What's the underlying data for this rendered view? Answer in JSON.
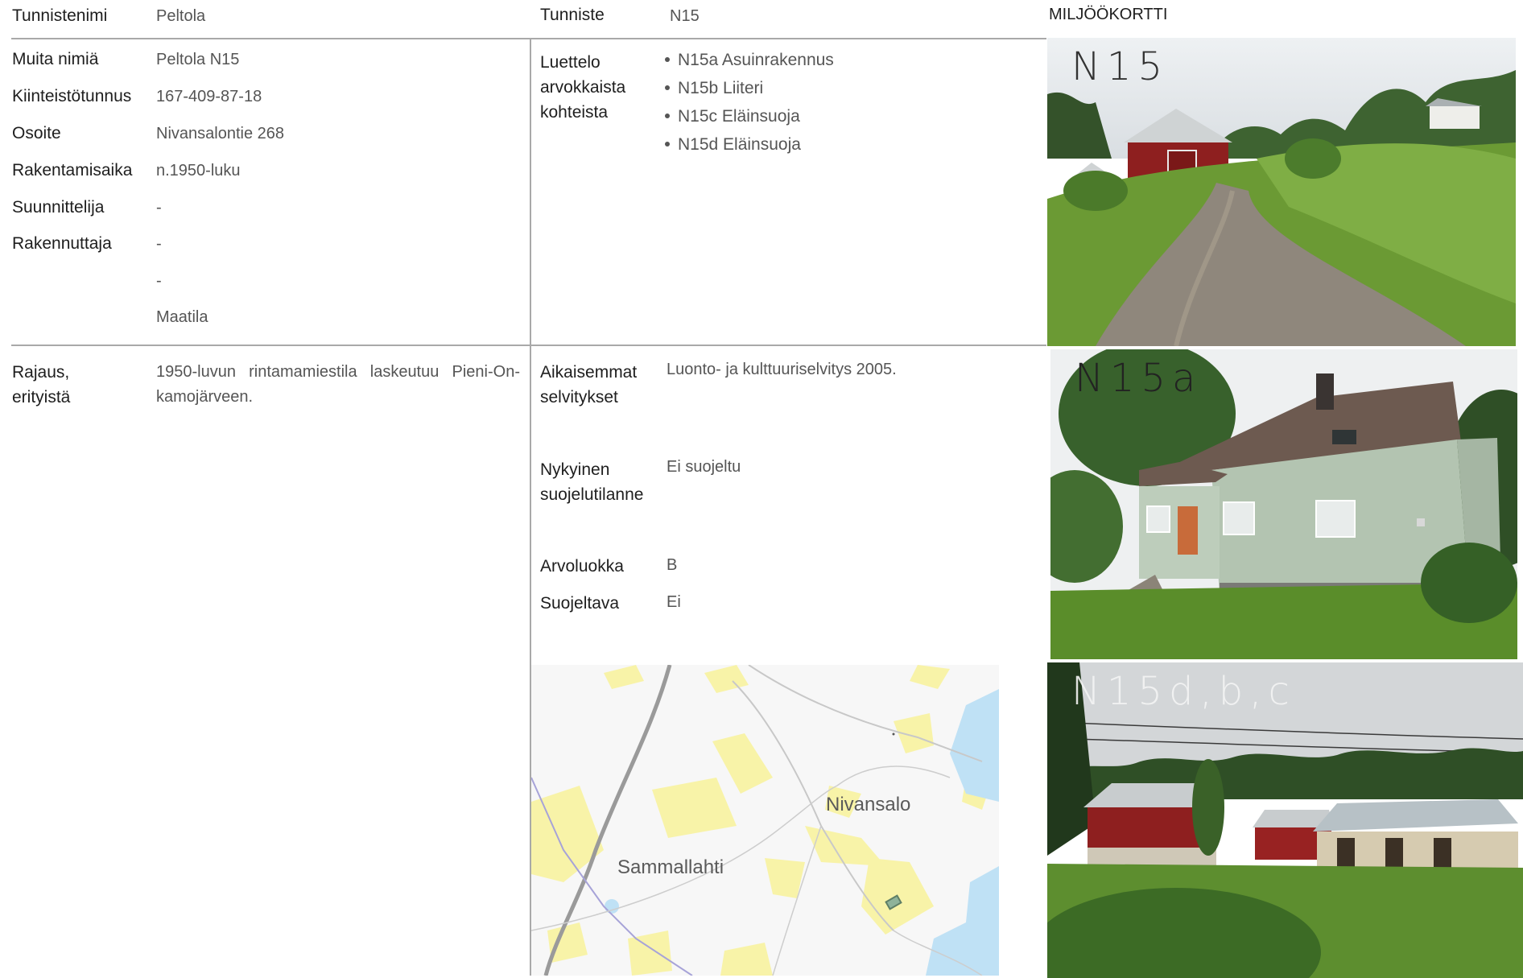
{
  "header": {
    "name_label": "Tunnistenimi",
    "name_value": "Peltola",
    "id_label": "Tunniste",
    "id_value": "N15",
    "card_title": "MILJÖÖKORTTI"
  },
  "fields": [
    {
      "label": "Muita nimiä",
      "value": "Peltola N15"
    },
    {
      "label": "Kiinteistötunnus",
      "value": "167-409-87-18"
    },
    {
      "label": "Osoite",
      "value": "Nivansalontie 268"
    },
    {
      "label": "Rakentamisaika",
      "value": "n.1950-luku"
    },
    {
      "label": "Suunnittelija",
      "value": "-"
    },
    {
      "label": "Rakennuttaja",
      "value": "-"
    },
    {
      "label": "",
      "value": "-"
    },
    {
      "label": "",
      "value": "Maatila"
    }
  ],
  "list": {
    "label_line1": "Luettelo",
    "label_line2": "arvokkaista",
    "label_line3": "kohteista",
    "items": [
      "N15a Asuinrakennus",
      "N15b Liiteri",
      "N15c Eläinsuoja",
      "N15d Eläinsuoja"
    ]
  },
  "rajaus": {
    "label_line1": "Rajaus,",
    "label_line2": "erityistä",
    "text_line1": "1950-luvun rintamamiestila laskeutuu Pieni-On-",
    "text_line2": "kamojärveen."
  },
  "details": {
    "earlier_label_line1": "Aikaisemmat",
    "earlier_label_line2": "selvitykset",
    "earlier_value": "Luonto- ja kulttuuriselvitys 2005.",
    "status_label_line1": "Nykyinen",
    "status_label_line2": "suojelutilanne",
    "status_value": "Ei suojeltu",
    "class_label": "Arvoluokka",
    "class_value": "B",
    "protect_label": "Suojeltava",
    "protect_value": "Ei"
  },
  "map": {
    "place1": "Nivansalo",
    "place2": "Sammallahti"
  },
  "photos": {
    "photo1_label": "N15",
    "photo2_label": "N15a",
    "photo3_label": "N15d,b,c"
  },
  "colors": {
    "barn_red": "#8e1f1f",
    "grass": "#5a8d2a",
    "house_green": "#b3c4b1",
    "map_water": "#bfe1f5",
    "map_field": "#f8f3a8"
  }
}
